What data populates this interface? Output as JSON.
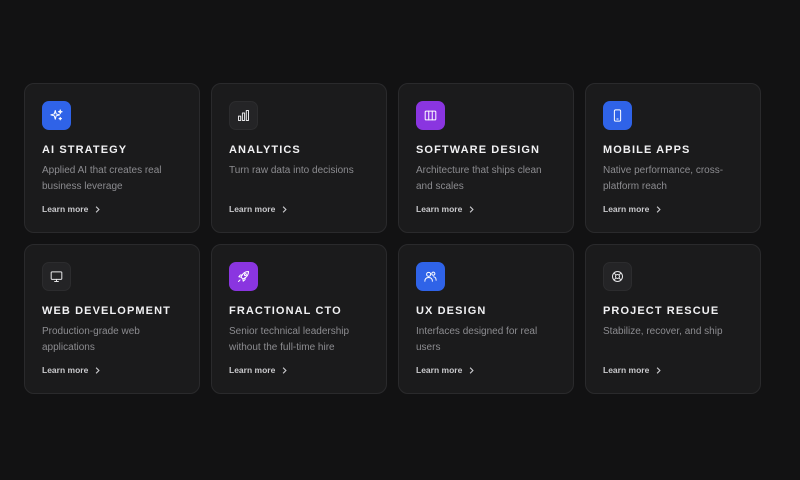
{
  "services": [
    {
      "title": "AI STRATEGY",
      "desc": "Applied AI that creates real business leverage",
      "cta": "Learn more",
      "icon": "sparkles-icon",
      "color": "#2f63e8"
    },
    {
      "title": "ANALYTICS",
      "desc": "Turn raw data into decisions",
      "cta": "Learn more",
      "icon": "bar-chart-icon",
      "color": "#242426"
    },
    {
      "title": "SOFTWARE DESIGN",
      "desc": "Architecture that ships clean and scales",
      "cta": "Learn more",
      "icon": "columns-icon",
      "color": "#8a35e0"
    },
    {
      "title": "MOBILE APPS",
      "desc": "Native performance, cross-platform reach",
      "cta": "Learn more",
      "icon": "smartphone-icon",
      "color": "#2f63e8"
    },
    {
      "title": "WEB DEVELOPMENT",
      "desc": "Production-grade web applications",
      "cta": "Learn more",
      "icon": "monitor-icon",
      "color": "#242426"
    },
    {
      "title": "FRACTIONAL CTO",
      "desc": "Senior technical leadership without the full-time hire",
      "cta": "Learn more",
      "icon": "rocket-icon",
      "color": "#8a35e0"
    },
    {
      "title": "UX DESIGN",
      "desc": "Interfaces designed for real users",
      "cta": "Learn more",
      "icon": "users-icon",
      "color": "#2f63e8"
    },
    {
      "title": "PROJECT RESCUE",
      "desc": "Stabilize, recover, and ship",
      "cta": "Learn more",
      "icon": "lifebuoy-icon",
      "color": "#242426"
    }
  ]
}
